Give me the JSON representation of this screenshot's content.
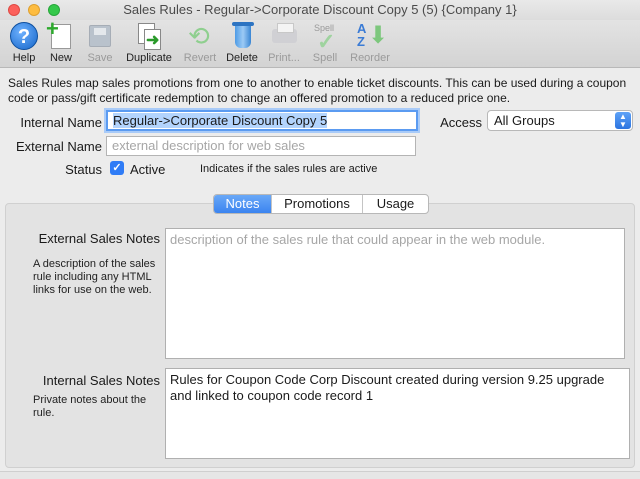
{
  "window": {
    "title": "Sales Rules - Regular->Corporate Discount Copy 5 (5) {Company 1}"
  },
  "toolbar": {
    "items": [
      {
        "label": "Help",
        "icon": "help-icon"
      },
      {
        "label": "New",
        "icon": "new-document-icon"
      },
      {
        "label": "Save",
        "icon": "save-icon"
      },
      {
        "label": "Duplicate",
        "icon": "duplicate-icon"
      },
      {
        "label": "Revert",
        "icon": "revert-icon"
      },
      {
        "label": "Delete",
        "icon": "trash-icon"
      },
      {
        "label": "Print...",
        "icon": "printer-icon"
      },
      {
        "label": "Spell",
        "icon": "spell-check-icon",
        "icon_text": "Spell"
      },
      {
        "label": "Reorder",
        "icon": "reorder-az-icon",
        "icon_text": [
          "A",
          "Z"
        ]
      }
    ]
  },
  "description": "Sales Rules map sales promotions from one to another to enable ticket discounts.  This can be used during a coupon code or pass/gift certificate redemption to change an offered promotion to a reduced price one.",
  "form": {
    "internal_name_label": "Internal Name",
    "internal_name_value": "Regular->Corporate Discount Copy 5",
    "external_name_label": "External Name",
    "external_name_placeholder": "external description for web sales",
    "access_label": "Access",
    "access_value": "All Groups",
    "status_label": "Status",
    "status_checkbox_label": "Active",
    "status_checked": true,
    "status_hint": "Indicates if the sales rules are active"
  },
  "tabs": [
    {
      "label": "Notes",
      "active": true
    },
    {
      "label": "Promotions",
      "active": false
    },
    {
      "label": "Usage",
      "active": false
    }
  ],
  "notes": {
    "external_label": "External Sales Notes",
    "external_sub": "A description of the sales rule including any HTML links for use on the web.",
    "external_placeholder": "description of the sales rule that could appear in the web module.",
    "internal_label": "Internal Sales Notes",
    "internal_sub": "Private notes about the rule.",
    "internal_value": "Rules for Coupon Code Corp Discount created during version 9.25 upgrade and linked to coupon code record 1"
  }
}
